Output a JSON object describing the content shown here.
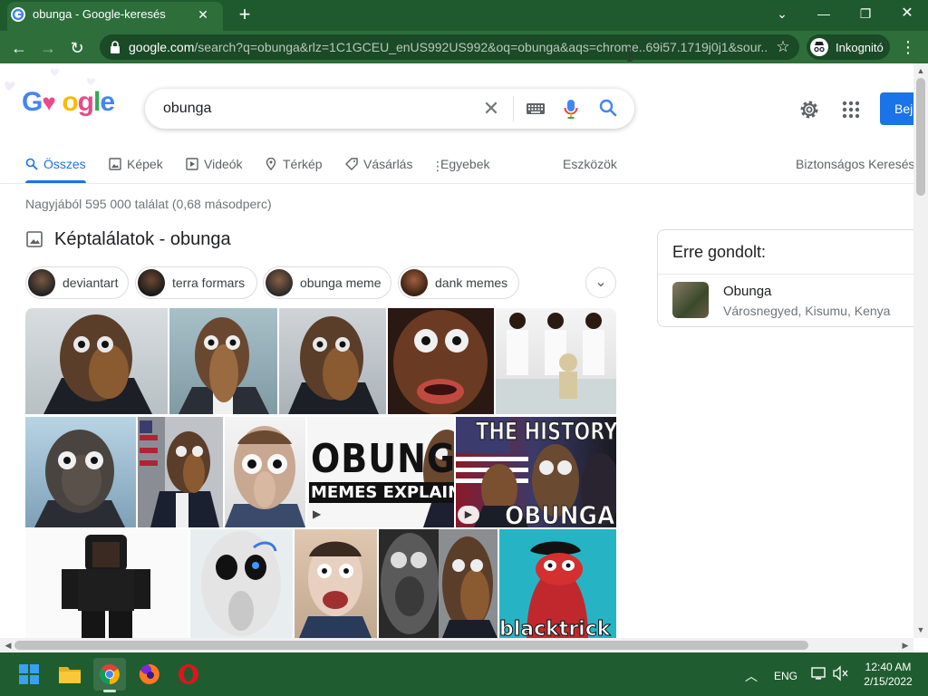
{
  "browser": {
    "tab_title": "obunga - Google-keresés",
    "url_host": "google.com",
    "url_path": "/search?q=obunga&rlz=1C1GCEU_enUS992US992&oq=obunga&aqs=chrome..69i57.1719j0j1&sour...",
    "incognito_label": "Inkognitó"
  },
  "header": {
    "logo_letters": [
      "G",
      "o",
      "o",
      "g",
      "l",
      "e"
    ],
    "query": "obunga",
    "signin_label": "Bej"
  },
  "tabs": [
    {
      "label": "Összes",
      "icon": "search-icon"
    },
    {
      "label": "Képek",
      "icon": "image-icon"
    },
    {
      "label": "Videók",
      "icon": "video-icon"
    },
    {
      "label": "Térkép",
      "icon": "map-pin-icon"
    },
    {
      "label": "Vásárlás",
      "icon": "tag-icon"
    },
    {
      "label": "Egyebek",
      "icon": "more-vert-icon"
    }
  ],
  "tools_label": "Eszközök",
  "safesearch_label": "Biztonságos Keresés",
  "result_stats": "Nagyjából 595 000 találat (0,68 másodperc)",
  "image_results": {
    "title": "Képtalálatok - obunga",
    "chips": [
      "deviantart",
      "terra formars",
      "obunga meme",
      "dank memes"
    ],
    "thumb_texts": {
      "obunga_title": "OBUNGA",
      "memes_explained": "MEMES EXPLAINED",
      "history_of": "THE HISTORY OF",
      "history_obunga": "OBUNGA",
      "blacktrick": "blacktrick"
    }
  },
  "knowledge_panel": {
    "heading": "Erre gondolt:",
    "name": "Obunga",
    "subtitle": "Városnegyed, Kisumu, Kenya"
  },
  "taskbar": {
    "language": "ENG",
    "time": "12:40 AM",
    "date": "2/15/2022"
  },
  "colors": {
    "browser_frame": "#1e5a2e",
    "google_blue": "#1a73e8",
    "taskbar": "#1f5d30"
  }
}
